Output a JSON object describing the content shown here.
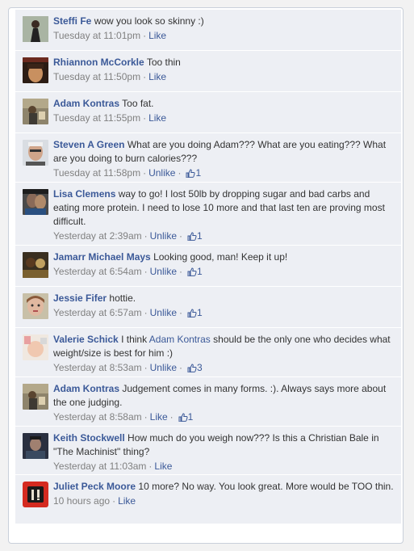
{
  "comments": [
    {
      "name": "Steffi Fe",
      "text": "wow you look so skinny :)",
      "time": "Tuesday at 11:01pm",
      "action": "Like",
      "likes": "",
      "avatar": "avatar-steffi"
    },
    {
      "name": "Rhiannon McCorkle",
      "text": "Too thin",
      "time": "Tuesday at 11:50pm",
      "action": "Like",
      "likes": "",
      "avatar": "avatar-rhiannon"
    },
    {
      "name": "Adam Kontras",
      "text": "Too fat.",
      "time": "Tuesday at 11:55pm",
      "action": "Like",
      "likes": "",
      "avatar": "avatar-adam"
    },
    {
      "name": "Steven A Green",
      "text": "What are you doing Adam??? What are you eating??? What are you doing to burn calories???",
      "time": "Tuesday at 11:58pm",
      "action": "Unlike",
      "likes": "1",
      "avatar": "avatar-steven"
    },
    {
      "name": "Lisa Clemens",
      "text": "way to go! I lost 50lb by dropping sugar and bad carbs and eating more protein. I need to lose 10 more and that last ten are proving most difficult.",
      "time": "Yesterday at 2:39am",
      "action": "Unlike",
      "likes": "1",
      "avatar": "avatar-lisa"
    },
    {
      "name": "Jamarr Michael Mays",
      "text": "Looking good, man! Keep it up!",
      "time": "Yesterday at 6:54am",
      "action": "Unlike",
      "likes": "1",
      "avatar": "avatar-jamarr"
    },
    {
      "name": "Jessie Fifer",
      "text": "hottie.",
      "time": "Yesterday at 6:57am",
      "action": "Unlike",
      "likes": "1",
      "avatar": "avatar-jessie"
    },
    {
      "name": "Valerie Schick",
      "text_before": "I think",
      "text_link": "Adam Kontras",
      "text_after": "should be the only one who decides what weight/size is best for him :)",
      "time": "Yesterday at 8:53am",
      "action": "Unlike",
      "likes": "3",
      "avatar": "avatar-valerie"
    },
    {
      "name": "Adam Kontras",
      "text": "Judgement comes in many forms. :). Always says more about the one judging.",
      "time": "Yesterday at 8:58am",
      "action": "Like",
      "likes": "1",
      "avatar": "avatar-adam-2"
    },
    {
      "name": "Keith Stockwell",
      "text": "How much do you weigh now??? Is this a Christian Bale in \"The Machinist\" thing?",
      "time": "Yesterday at 11:03am",
      "action": "Like",
      "likes": "",
      "avatar": "avatar-keith"
    },
    {
      "name": "Juliet Peck Moore",
      "text": "10 more? No way. You look great. More would be TOO thin.",
      "time": "10 hours ago",
      "action": "Like",
      "likes": "",
      "avatar": "avatar-juliet"
    }
  ],
  "colors": {
    "link": "#3b5998",
    "comment_bg": "#edeff4",
    "meta": "#808080"
  }
}
